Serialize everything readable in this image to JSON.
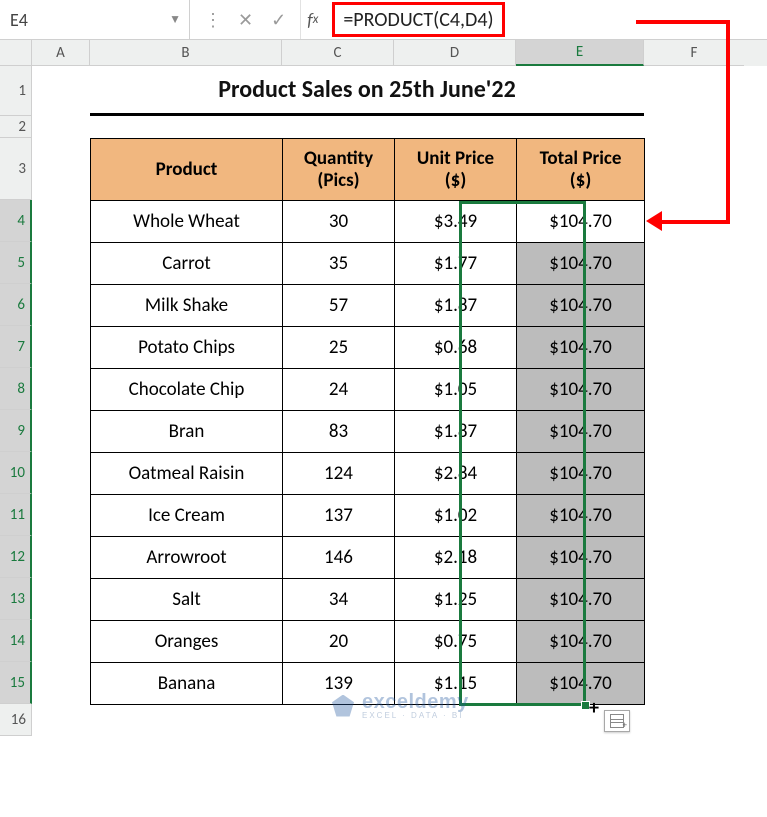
{
  "namebox": "E4",
  "formula": "=PRODUCT(C4,D4)",
  "columns": [
    "A",
    "B",
    "C",
    "D",
    "E",
    "F"
  ],
  "row_numbers": [
    1,
    2,
    3,
    4,
    5,
    6,
    7,
    8,
    9,
    10,
    11,
    12,
    13,
    14,
    15,
    16
  ],
  "title": "Product Sales on 25th June'22",
  "headers": {
    "product": "Product",
    "qty_l1": "Quantity",
    "qty_l2": "(Pics)",
    "price_l1": "Unit Price",
    "price_l2": "($)",
    "total_l1": "Total Price",
    "total_l2": "($)"
  },
  "rows": [
    {
      "product": "Whole Wheat",
      "qty": "30",
      "price": "$3.49",
      "total": "$104.70"
    },
    {
      "product": "Carrot",
      "qty": "35",
      "price": "$1.77",
      "total": "$104.70"
    },
    {
      "product": "Milk Shake",
      "qty": "57",
      "price": "$1.87",
      "total": "$104.70"
    },
    {
      "product": "Potato Chips",
      "qty": "25",
      "price": "$0.68",
      "total": "$104.70"
    },
    {
      "product": "Chocolate Chip",
      "qty": "24",
      "price": "$1.05",
      "total": "$104.70"
    },
    {
      "product": "Bran",
      "qty": "83",
      "price": "$1.87",
      "total": "$104.70"
    },
    {
      "product": "Oatmeal Raisin",
      "qty": "124",
      "price": "$2.84",
      "total": "$104.70"
    },
    {
      "product": "Ice Cream",
      "qty": "137",
      "price": "$1.02",
      "total": "$104.70"
    },
    {
      "product": "Arrowroot",
      "qty": "146",
      "price": "$2.18",
      "total": "$104.70"
    },
    {
      "product": "Salt",
      "qty": "34",
      "price": "$1.25",
      "total": "$104.70"
    },
    {
      "product": "Oranges",
      "qty": "20",
      "price": "$0.75",
      "total": "$104.70"
    },
    {
      "product": "Banana",
      "qty": "139",
      "price": "$1.15",
      "total": "$104.70"
    }
  ],
  "watermark": {
    "name": "exceldemy",
    "tag": "EXCEL · DATA · BI"
  },
  "chart_data": {
    "type": "table",
    "title": "Product Sales on 25th June'22",
    "columns": [
      "Product",
      "Quantity (Pics)",
      "Unit Price ($)",
      "Total Price ($)"
    ],
    "data": [
      [
        "Whole Wheat",
        30,
        3.49,
        104.7
      ],
      [
        "Carrot",
        35,
        1.77,
        104.7
      ],
      [
        "Milk Shake",
        57,
        1.87,
        104.7
      ],
      [
        "Potato Chips",
        25,
        0.68,
        104.7
      ],
      [
        "Chocolate Chip",
        24,
        1.05,
        104.7
      ],
      [
        "Bran",
        83,
        1.87,
        104.7
      ],
      [
        "Oatmeal Raisin",
        124,
        2.84,
        104.7
      ],
      [
        "Ice Cream",
        137,
        1.02,
        104.7
      ],
      [
        "Arrowroot",
        146,
        2.18,
        104.7
      ],
      [
        "Salt",
        34,
        1.25,
        104.7
      ],
      [
        "Oranges",
        20,
        0.75,
        104.7
      ],
      [
        "Banana",
        139,
        1.15,
        104.7
      ]
    ],
    "note": "Total Price column shows filled-down value from E4 formula =PRODUCT(C4,D4); all cells display $104.70"
  }
}
